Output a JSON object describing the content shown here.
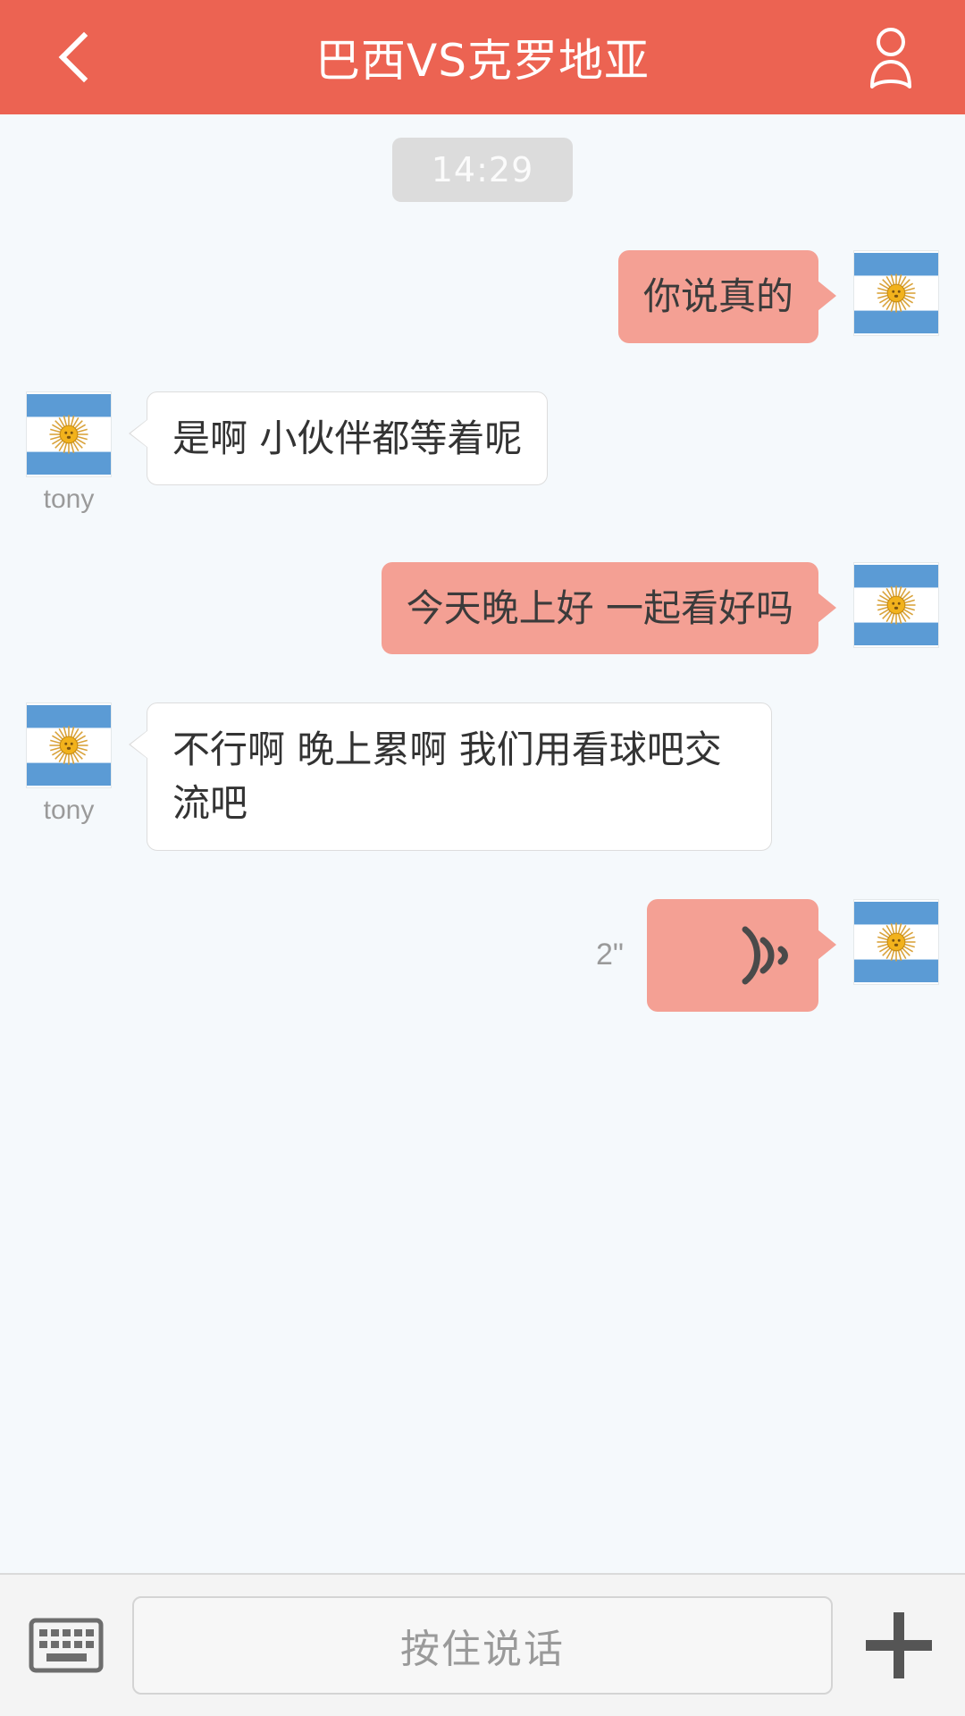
{
  "header": {
    "title": "巴西VS克罗地亚",
    "back_icon": "back-chevron-icon",
    "profile_icon": "person-icon",
    "background_color": "#ec6352"
  },
  "chat": {
    "timestamp": "14:29",
    "background_color": "#f5f9fc",
    "outgoing_bubble_color": "#f4a094",
    "incoming_bubble_color": "#ffffff",
    "messages": [
      {
        "direction": "outgoing",
        "type": "text",
        "text": "你说真的",
        "avatar": "argentina-flag-avatar",
        "sender_name": ""
      },
      {
        "direction": "incoming",
        "type": "text",
        "text": "是啊  小伙伴都等着呢",
        "avatar": "argentina-flag-avatar",
        "sender_name": "tony"
      },
      {
        "direction": "outgoing",
        "type": "text",
        "text": "今天晚上好  一起看好吗",
        "avatar": "argentina-flag-avatar",
        "sender_name": ""
      },
      {
        "direction": "incoming",
        "type": "text",
        "text": "不行啊  晚上累啊  我们用看球吧交流吧",
        "avatar": "argentina-flag-avatar",
        "sender_name": "tony"
      },
      {
        "direction": "outgoing",
        "type": "voice",
        "duration": "2\"",
        "icon": "sound-wave-icon",
        "avatar": "argentina-flag-avatar",
        "sender_name": ""
      }
    ]
  },
  "input_bar": {
    "keyboard_icon": "keyboard-icon",
    "talk_label": "按住说话",
    "plus_icon": "plus-icon",
    "background_color": "#f4f4f4"
  }
}
